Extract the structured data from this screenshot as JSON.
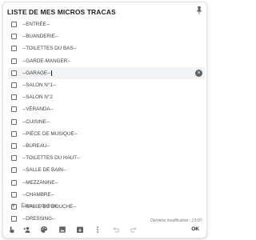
{
  "note": {
    "title": "LISTE DE MES MICROS TRACAS",
    "items": [
      {
        "label": "--ENTRÉE--",
        "checked": false
      },
      {
        "label": "--BUANDERIE--",
        "checked": false
      },
      {
        "label": "--TOILETTES DU BAS--",
        "checked": false
      },
      {
        "label": "--GARDE-MANGER--",
        "checked": false
      },
      {
        "label": "--GARAGE--",
        "checked": false
      },
      {
        "label": "--SALON N°1--",
        "checked": false
      },
      {
        "label": "--SALON N°2",
        "checked": false
      },
      {
        "label": "--VÉRANDA--",
        "checked": false
      },
      {
        "label": "--CUISINE--",
        "checked": false
      },
      {
        "label": "--PIÈCE DE MUSIQUE--",
        "checked": false
      },
      {
        "label": "--BUREAU--",
        "checked": false
      },
      {
        "label": "--TOILETTES DU HAUT--",
        "checked": false
      },
      {
        "label": "--SALLE DE BAIN--",
        "checked": false
      },
      {
        "label": "--MEZZANINE--",
        "checked": false
      },
      {
        "label": "--CHAMBRE--",
        "checked": false
      },
      {
        "label": "--SALLE DE DOUCHE--",
        "checked": false
      },
      {
        "label": "--DRESSING--",
        "checked": false
      }
    ],
    "add_item_label": "Élément de liste",
    "last_modified": "Dernière modification : 13:00"
  },
  "toolbar": {
    "ok_label": "OK",
    "icons": [
      "hand-point-icon",
      "add-collaborator-icon",
      "palette-icon",
      "image-icon",
      "archive-icon",
      "more-vert-icon",
      "undo-icon",
      "redo-icon"
    ]
  }
}
